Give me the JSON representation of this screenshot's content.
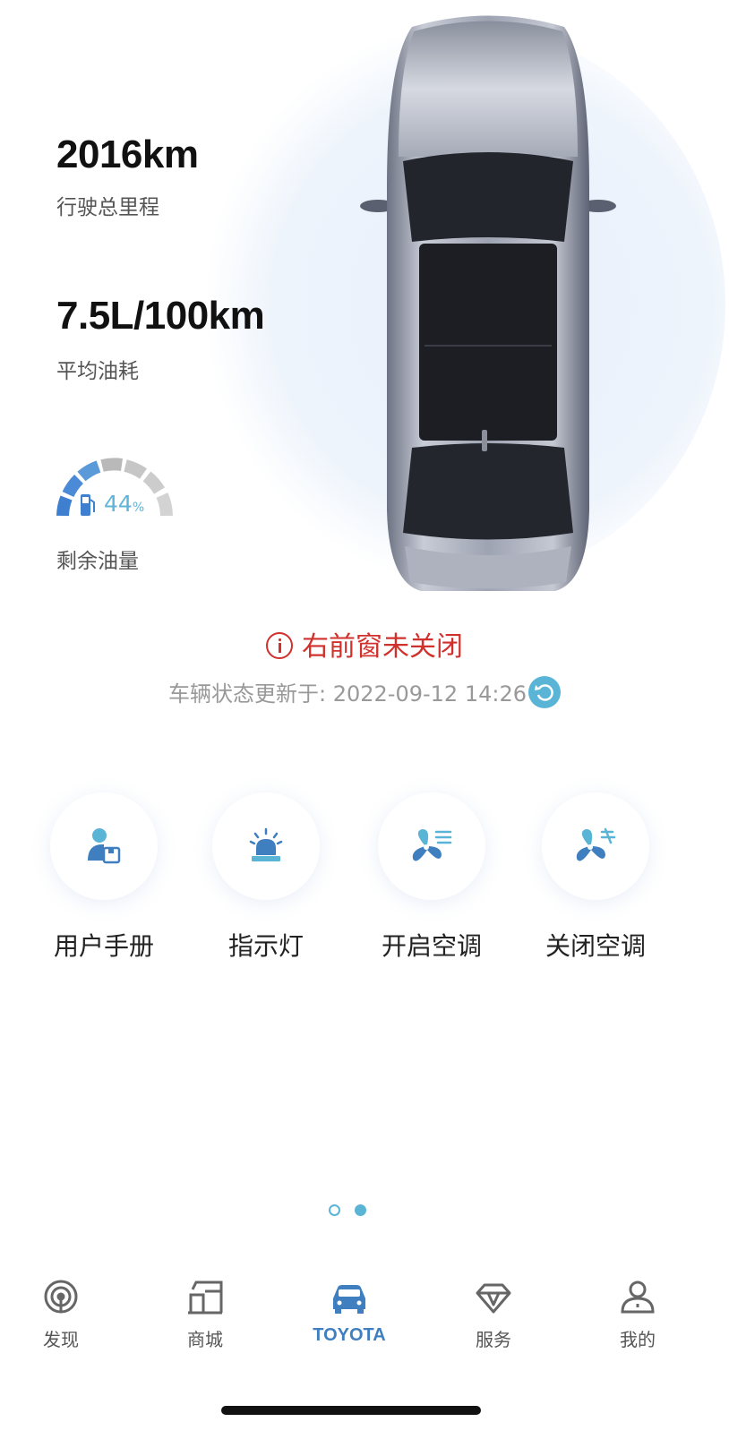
{
  "stats": {
    "mileage_value": "2016km",
    "mileage_label": "行驶总里程",
    "fuel_consumption_value": "7.5L/100km",
    "fuel_consumption_label": "平均油耗",
    "fuel_level_percent": "44",
    "fuel_level_unit": "%",
    "fuel_level_fraction": 0.44,
    "fuel_level_label": "剩余油量"
  },
  "alert": {
    "text": "右前窗未关闭",
    "color": "#d0312d"
  },
  "status_update": {
    "text": "车辆状态更新于: 2022-09-12 14:26"
  },
  "actions": [
    {
      "label": "用户手册",
      "icon": "user-manual-icon"
    },
    {
      "label": "指示灯",
      "icon": "warning-light-icon"
    },
    {
      "label": "开启空调",
      "icon": "ac-on-icon"
    },
    {
      "label": "关闭空调",
      "icon": "ac-off-icon"
    }
  ],
  "pagination": {
    "total": 2,
    "current": 2
  },
  "tabbar": {
    "items": [
      {
        "label": "发现",
        "icon": "discover-icon"
      },
      {
        "label": "商城",
        "icon": "store-icon"
      },
      {
        "label": "TOYOTA",
        "icon": "car-icon",
        "active": true
      },
      {
        "label": "服务",
        "icon": "service-icon"
      },
      {
        "label": "我的",
        "icon": "profile-icon"
      }
    ]
  },
  "colors": {
    "accent": "#5ab4d6",
    "active_tab": "#3f7fbf",
    "alert": "#d0312d"
  }
}
